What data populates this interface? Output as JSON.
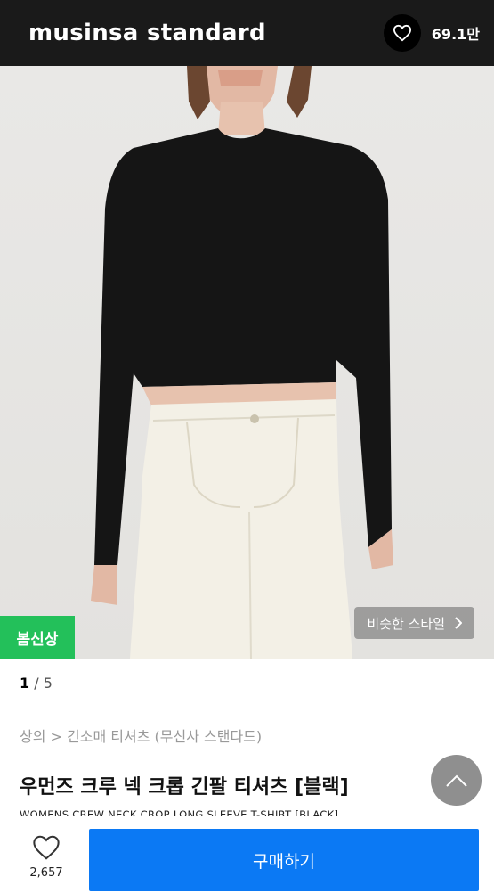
{
  "header": {
    "brand": "musinsa standard",
    "like_count": "69.1만"
  },
  "photo": {
    "badge": "봄신상",
    "similar_style": "비슷한 스타일"
  },
  "pager": {
    "current": "1",
    "separator": " / ",
    "total": "5"
  },
  "product": {
    "breadcrumb": "상의 > 긴소매 티셔츠 (무신사 스탠다드)",
    "title": "우먼즈 크루 넥 크롭 긴팔 티셔츠 [블랙]",
    "subtitle": "WOMENS CREW NECK CROP LONG SLEEVE T-SHIRT [BLACK]"
  },
  "bottom_bar": {
    "wish_count": "2,657",
    "buy_label": "구매하기"
  },
  "colors": {
    "header_bg": "#1a1a1a",
    "badge_green": "#23c05a",
    "buy_blue": "#0b79f4"
  }
}
